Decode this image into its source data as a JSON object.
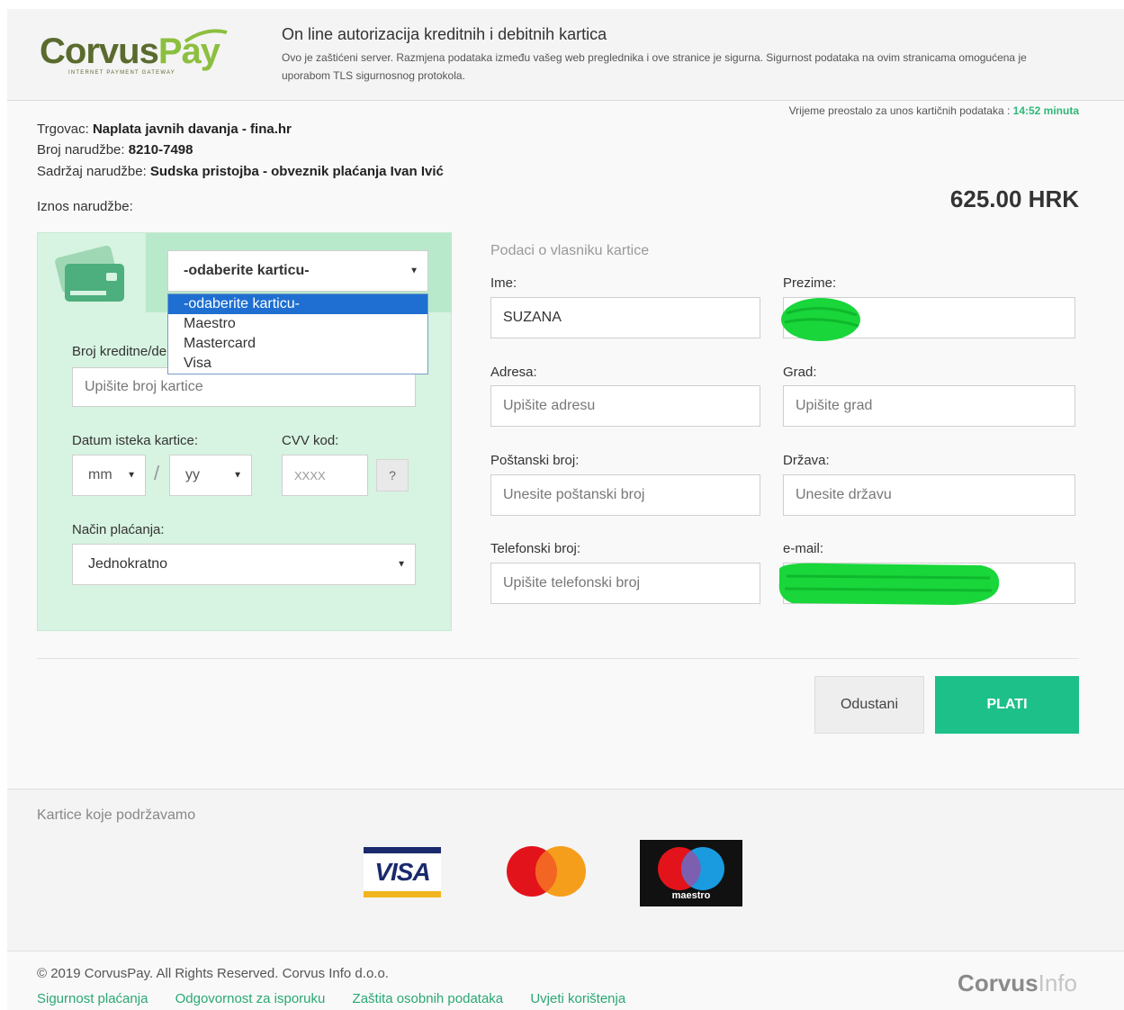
{
  "header": {
    "logo_main": "Corvus",
    "logo_accent": "Pay",
    "logo_sub": "INTERNET PAYMENT GATEWAY",
    "title": "On line autorizacija kreditnih i debitnih kartica",
    "note": "Ovo je zaštićeni server. Razmjena podataka između vašeg web preglednika i ove stranice je sigurna. Sigurnost podataka na ovim stranicama omogućena je uporabom TLS sigurnosnog protokola."
  },
  "order": {
    "merchant_label": "Trgovac:",
    "merchant_value": "Naplata javnih davanja - fina.hr",
    "number_label": "Broj narudžbe:",
    "number_value": "8210-7498",
    "content_label": "Sadržaj narudžbe:",
    "content_value": "Sudska pristojba - obveznik plaćanja Ivan Ivić",
    "amount_label": "Iznos narudžbe:",
    "amount_value": "625.00 HRK",
    "timer_label": "Vrijeme preostalo za unos kartičnih podataka :",
    "timer_value": "14:52 minuta"
  },
  "card": {
    "select_value": "-odaberite karticu-",
    "options": [
      "-odaberite karticu-",
      "Maestro",
      "Mastercard",
      "Visa"
    ],
    "number_label": "Broj kreditne/de",
    "number_placeholder": "Upišite broj kartice",
    "expiry_label": "Datum isteka kartice:",
    "month_value": "mm",
    "year_value": "yy",
    "separator": "/",
    "cvv_label": "CVV kod:",
    "cvv_placeholder": "XXXX",
    "help_label": "?",
    "payment_label": "Način plaćanja:",
    "payment_value": "Jednokratno"
  },
  "holder": {
    "section_title": "Podaci o vlasniku kartice",
    "first_name_label": "Ime:",
    "first_name_value": "SUZANA",
    "last_name_label": "Prezime:",
    "address_label": "Adresa:",
    "address_placeholder": "Upišite adresu",
    "city_label": "Grad:",
    "city_placeholder": "Upišite grad",
    "postal_label": "Poštanski broj:",
    "postal_placeholder": "Unesite poštanski broj",
    "country_label": "Država:",
    "country_placeholder": "Unesite državu",
    "phone_label": "Telefonski broj:",
    "phone_placeholder": "Upišite telefonski broj",
    "email_label": "e-mail:"
  },
  "actions": {
    "cancel": "Odustani",
    "pay": "PLATI"
  },
  "supported": {
    "title": "Kartice koje podržavamo",
    "visa": "VISA",
    "maestro": "maestro"
  },
  "footer": {
    "copyright": "© 2019 CorvusPay. All Rights Reserved. Corvus Info d.o.o.",
    "links": [
      "Sigurnost plaćanja",
      "Odgovornost za isporuku",
      "Zaštita osobnih podataka",
      "Uvjeti korištenja"
    ],
    "logo_a": "Corvus",
    "logo_b": "Info"
  },
  "colors": {
    "accent": "#1cc088",
    "panel": "#d7f3e1",
    "link": "#2aa774",
    "redaction": "#19d63a"
  }
}
